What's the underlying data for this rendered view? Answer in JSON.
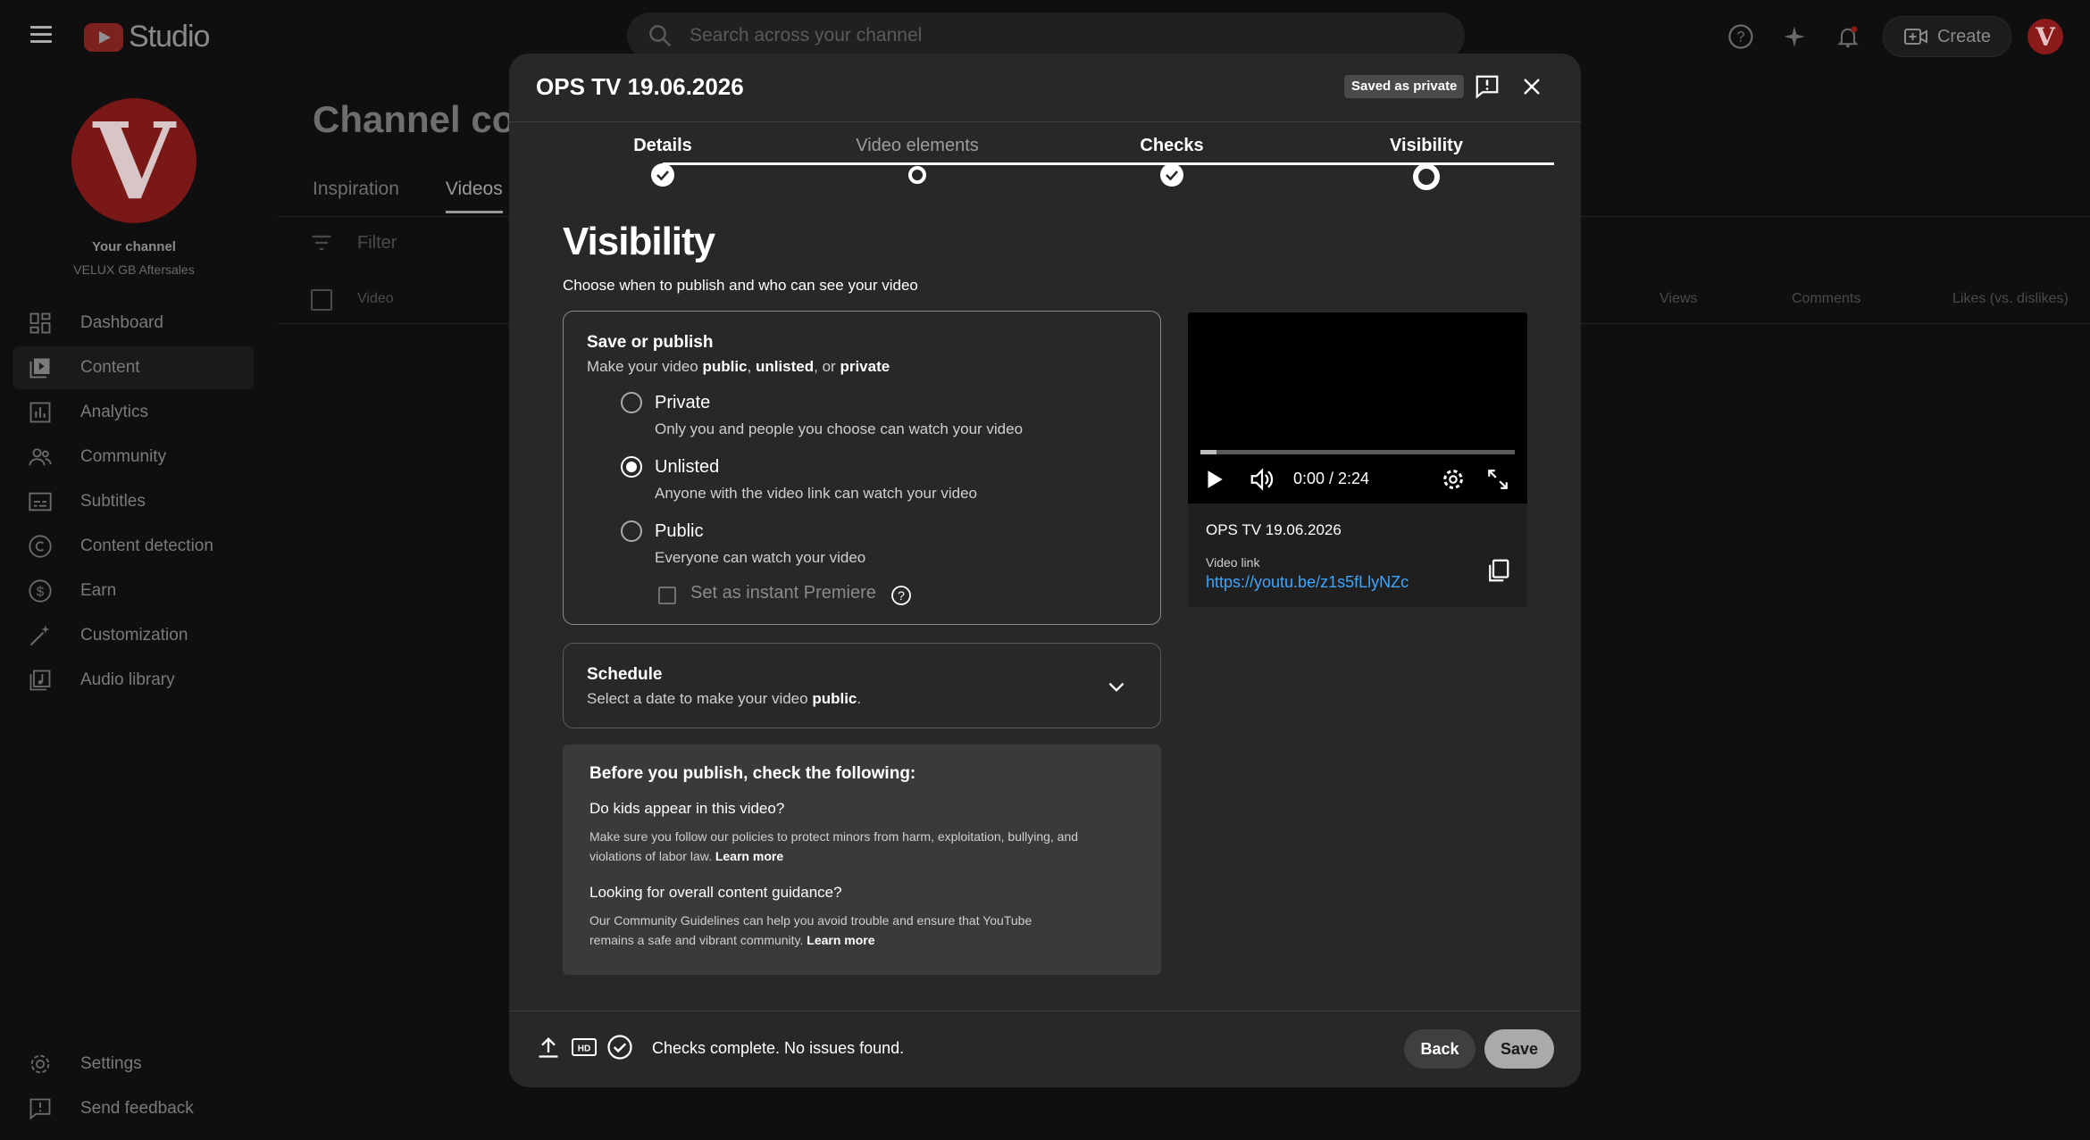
{
  "app": {
    "logo_text": "Studio"
  },
  "search": {
    "placeholder": "Search across your channel"
  },
  "topbar": {
    "create_label": "Create",
    "avatar_letter": "V"
  },
  "channel": {
    "avatar_letter": "V",
    "your_channel": "Your channel",
    "name": "VELUX GB Aftersales"
  },
  "sidebar": {
    "items": [
      {
        "label": "Dashboard",
        "icon": "dashboard-icon"
      },
      {
        "label": "Content",
        "icon": "content-icon",
        "active": true
      },
      {
        "label": "Analytics",
        "icon": "analytics-icon"
      },
      {
        "label": "Community",
        "icon": "community-icon"
      },
      {
        "label": "Subtitles",
        "icon": "subtitles-icon"
      },
      {
        "label": "Content detection",
        "icon": "copyright-icon"
      },
      {
        "label": "Earn",
        "icon": "dollar-icon"
      },
      {
        "label": "Customization",
        "icon": "magic-wand-icon"
      },
      {
        "label": "Audio library",
        "icon": "audio-library-icon"
      }
    ],
    "bottom": [
      {
        "label": "Settings",
        "icon": "gear-icon"
      },
      {
        "label": "Send feedback",
        "icon": "feedback-icon"
      }
    ]
  },
  "page": {
    "title": "Channel con",
    "tabs": [
      "Inspiration",
      "Videos"
    ],
    "filter_placeholder": "Filter",
    "columns": {
      "video": "Video",
      "views": "Views",
      "comments": "Comments",
      "likes": "Likes (vs. dislikes)"
    }
  },
  "modal": {
    "title": "OPS TV 19.06.2026",
    "saved_badge": "Saved as private",
    "steps": [
      {
        "label": "Details",
        "state": "done"
      },
      {
        "label": "Video elements",
        "state": "incomplete"
      },
      {
        "label": "Checks",
        "state": "done"
      },
      {
        "label": "Visibility",
        "state": "current"
      }
    ],
    "heading": "Visibility",
    "subheading": "Choose when to publish and who can see your video",
    "save_publish": {
      "title": "Save or publish",
      "sub_prefix": "Make your video ",
      "sub_public": "public",
      "sub_sep1": ", ",
      "sub_unlisted": "unlisted",
      "sub_sep2": ", or ",
      "sub_private": "private",
      "options": [
        {
          "label": "Private",
          "desc": "Only you and people you choose can watch your video",
          "selected": false
        },
        {
          "label": "Unlisted",
          "desc": "Anyone with the video link can watch your video",
          "selected": true
        },
        {
          "label": "Public",
          "desc": "Everyone can watch your video",
          "selected": false
        }
      ],
      "premiere_label": "Set as instant Premiere"
    },
    "schedule": {
      "title": "Schedule",
      "sub_prefix": "Select a date to make your video ",
      "sub_bold": "public",
      "sub_suffix": "."
    },
    "guidance": {
      "title": "Before you publish, check the following:",
      "q1": "Do kids appear in this video?",
      "t1": "Make sure you follow our policies to protect minors from harm, exploitation, bullying, and violations of labor law.",
      "q2": "Looking for overall content guidance?",
      "t2": "Our Community Guidelines can help you avoid trouble and ensure that YouTube remains a safe and vibrant community.",
      "learn_more": "Learn more"
    },
    "preview": {
      "time": "0:00 / 2:24",
      "progress_fraction": 0.05,
      "title": "OPS TV 19.06.2026",
      "link_label": "Video link",
      "link": "https://youtu.be/z1s5fLlyNZc"
    },
    "footer": {
      "status": "Checks complete. No issues found.",
      "back": "Back",
      "save": "Save"
    }
  },
  "colors": {
    "accent_link": "#3ea6ff",
    "brand_red": "#c4302b",
    "modal_bg": "#282828"
  }
}
